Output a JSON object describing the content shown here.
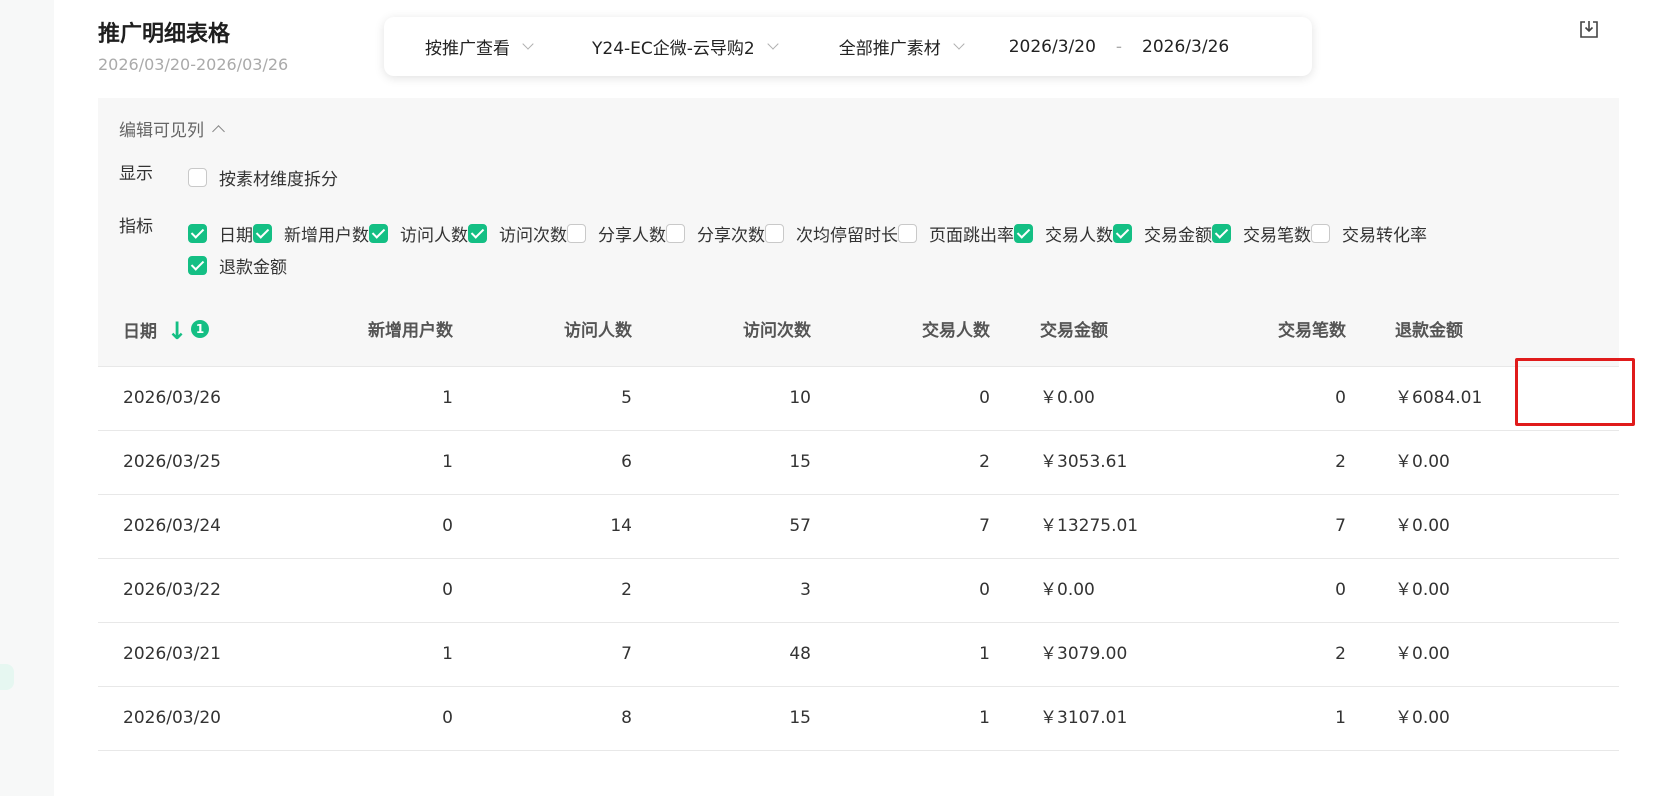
{
  "header": {
    "title": "推广明细表格",
    "date_range": "2026/03/20-2026/03/26"
  },
  "filters": {
    "view_by": "按推广查看",
    "campaign": "Y24-EC企微-云导购2",
    "material": "全部推广素材",
    "start_date": "2026/3/20",
    "separator": "-",
    "end_date": "2026/3/26"
  },
  "column_editor": {
    "toggle_label": "编辑可见列",
    "display_label": "显示",
    "split_option": {
      "label": "按素材维度拆分",
      "checked": false
    },
    "metrics_label": "指标",
    "metrics": [
      {
        "label": "日期",
        "checked": true
      },
      {
        "label": "新增用户数",
        "checked": true
      },
      {
        "label": "访问人数",
        "checked": true
      },
      {
        "label": "访问次数",
        "checked": true
      },
      {
        "label": "分享人数",
        "checked": false
      },
      {
        "label": "分享次数",
        "checked": false
      },
      {
        "label": "次均停留时长",
        "checked": false
      },
      {
        "label": "页面跳出率",
        "checked": false
      },
      {
        "label": "交易人数",
        "checked": true
      },
      {
        "label": "交易金额",
        "checked": true
      },
      {
        "label": "交易笔数",
        "checked": true
      },
      {
        "label": "交易转化率",
        "checked": false
      },
      {
        "label": "退款金额",
        "checked": true
      }
    ]
  },
  "table": {
    "sort_badge": "1",
    "columns": [
      "日期",
      "新增用户数",
      "访问人数",
      "访问次数",
      "交易人数",
      "交易金额",
      "交易笔数",
      "退款金额"
    ],
    "rows": [
      [
        "2026/03/26",
        "1",
        "5",
        "10",
        "0",
        "￥0.00",
        "0",
        "￥6084.01"
      ],
      [
        "2026/03/25",
        "1",
        "6",
        "15",
        "2",
        "￥3053.61",
        "2",
        "￥0.00"
      ],
      [
        "2026/03/24",
        "0",
        "14",
        "57",
        "7",
        "￥13275.01",
        "7",
        "￥0.00"
      ],
      [
        "2026/03/22",
        "0",
        "2",
        "3",
        "0",
        "￥0.00",
        "0",
        "￥0.00"
      ],
      [
        "2026/03/21",
        "1",
        "7",
        "48",
        "1",
        "￥3079.00",
        "2",
        "￥0.00"
      ],
      [
        "2026/03/20",
        "0",
        "8",
        "15",
        "1",
        "￥3107.01",
        "1",
        "￥0.00"
      ]
    ]
  },
  "colors": {
    "accent": "#14bf84",
    "highlight": "#e01b1b"
  },
  "icons": {
    "export": "export-icon",
    "sort": "arrow-down-icon"
  }
}
